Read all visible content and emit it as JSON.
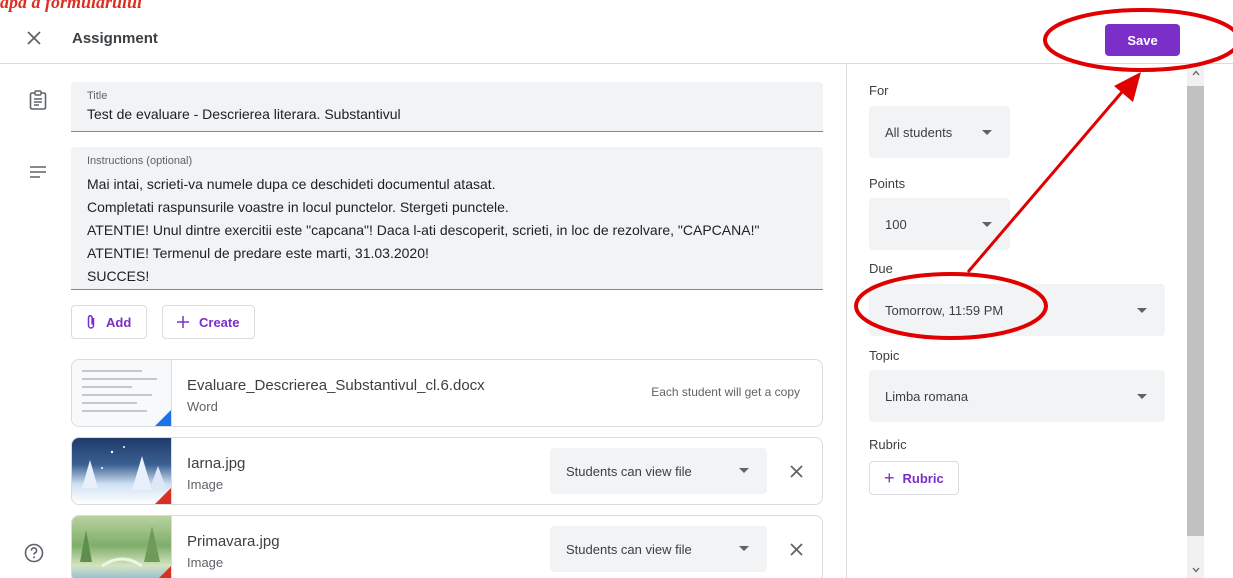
{
  "caption": "apa a formularului",
  "header": {
    "title": "Assignment",
    "save_label": "Save"
  },
  "title_field": {
    "label": "Title",
    "value": "Test de evaluare - Descrierea literara. Substantivul"
  },
  "instructions_field": {
    "label": "Instructions (optional)",
    "lines": [
      "Mai intai, scrieti-va numele dupa ce deschideti documentul atasat.",
      "Completati raspunsurile voastre in locul punctelor. Stergeti punctele.",
      "ATENTIE! Unul dintre exercitii este \"capcana\"! Daca l-ati descoperit, scrieti, in loc de rezolvare, \"CAPCANA!\"",
      "ATENTIE! Termenul de predare este marti, 31.03.2020!",
      "SUCCES!"
    ]
  },
  "actions": {
    "add_label": "Add",
    "create_label": "Create"
  },
  "attachments": [
    {
      "name": "Evaluare_Descrierea_Substantivul_cl.6.docx",
      "type": "Word",
      "note": "Each student will get a copy"
    },
    {
      "name": "Iarna.jpg",
      "type": "Image",
      "permission": "Students can view file"
    },
    {
      "name": "Primavara.jpg",
      "type": "Image",
      "permission": "Students can view file"
    }
  ],
  "side": {
    "for_label": "For",
    "for_value": "All students",
    "points_label": "Points",
    "points_value": "100",
    "due_label": "Due",
    "due_value": "Tomorrow, 11:59 PM",
    "topic_label": "Topic",
    "topic_value": "Limba romana",
    "rubric_label": "Rubric",
    "rubric_button": "Rubric"
  },
  "colors": {
    "accent": "#7b2ec8",
    "annotation": "#e00000"
  }
}
